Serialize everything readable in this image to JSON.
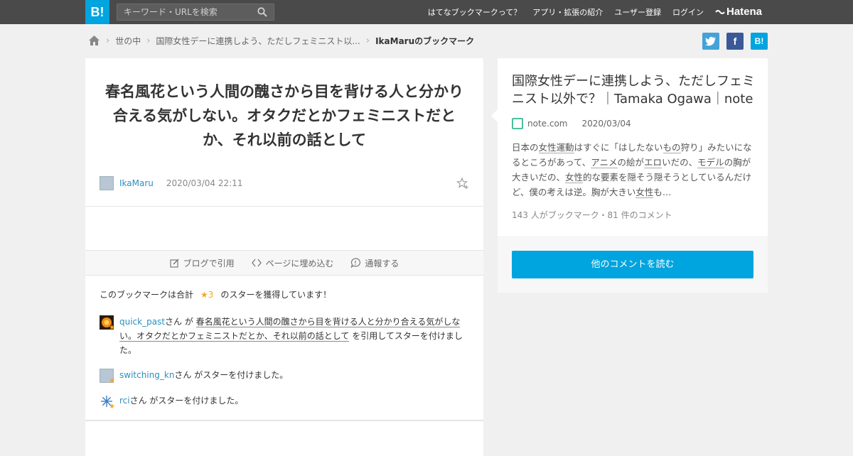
{
  "topbar": {
    "logo": "B!",
    "search_placeholder": "キーワード・URLを検索",
    "nav": [
      "はてなブックマークって？",
      "アプリ・拡張の紹介",
      "ユーザー登録",
      "ログイン"
    ],
    "brand": "Hatena"
  },
  "breadcrumb": {
    "items": [
      "世の中",
      "国際女性デーに連携しよう、ただしフェミニスト以...",
      "IkaMaruのブックマーク"
    ]
  },
  "share": {
    "twitter": "t",
    "facebook": "f",
    "hatena": "B!"
  },
  "bookmark": {
    "comment": "春名風花という人間の醜さから目を背ける人と分かり合える気がしない。オタクだとかフェミニストだとか、それ以前の話として",
    "user": "IkaMaru",
    "date": "2020/03/04 22:11"
  },
  "actions": {
    "blog_quote": "ブログで引用",
    "embed": "ページに埋め込む",
    "report": "通報する"
  },
  "stars": {
    "total_prefix": "このブックマークは合計",
    "total_count": "★3",
    "total_suffix": "のスターを獲得しています！",
    "entries": [
      {
        "user": "quick_past",
        "pre": "さん が ",
        "quote": "春名風花という人間の醜さから目を背ける人と分かり合える気がしない。オタクだとかフェミニストだとか、それ以前の話として",
        "post": " を引用してスターを付けました。"
      },
      {
        "user": "switching_kn",
        "post": "さん がスターを付けました。"
      },
      {
        "user": "rci",
        "post": "さん がスターを付けました。"
      }
    ]
  },
  "entry": {
    "title": "国際女性デーに連携しよう、ただしフェミニスト以外で？｜Tamaka Ogawa｜note",
    "domain": "note.com",
    "date": "2020/03/04",
    "summary_parts": [
      {
        "t": "日本の",
        "k": false
      },
      {
        "t": "女性運動",
        "k": true
      },
      {
        "t": "はすぐに「はしたない",
        "k": false
      },
      {
        "t": "もの",
        "k": true
      },
      {
        "t": "狩り」みたいになるところがあって、",
        "k": false
      },
      {
        "t": "アニメ",
        "k": true
      },
      {
        "t": "の絵が",
        "k": false
      },
      {
        "t": "エロ",
        "k": true
      },
      {
        "t": "いだの、",
        "k": false
      },
      {
        "t": "モデル",
        "k": true
      },
      {
        "t": "の胸が大きいだの、",
        "k": false
      },
      {
        "t": "女性",
        "k": true
      },
      {
        "t": "的な要素を隠そう隠そうとしているんだけど、僕の考えは逆。胸が大きい",
        "k": false
      },
      {
        "t": "女性",
        "k": true
      },
      {
        "t": "も…",
        "k": false
      }
    ],
    "counts": "143 人がブックマーク・81 件のコメント",
    "read_button": "他のコメントを読む"
  },
  "colors": {
    "accent": "#00a4de",
    "topbar": "#4a4a4a",
    "star": "#f5a623",
    "link": "#2c8fbf"
  }
}
